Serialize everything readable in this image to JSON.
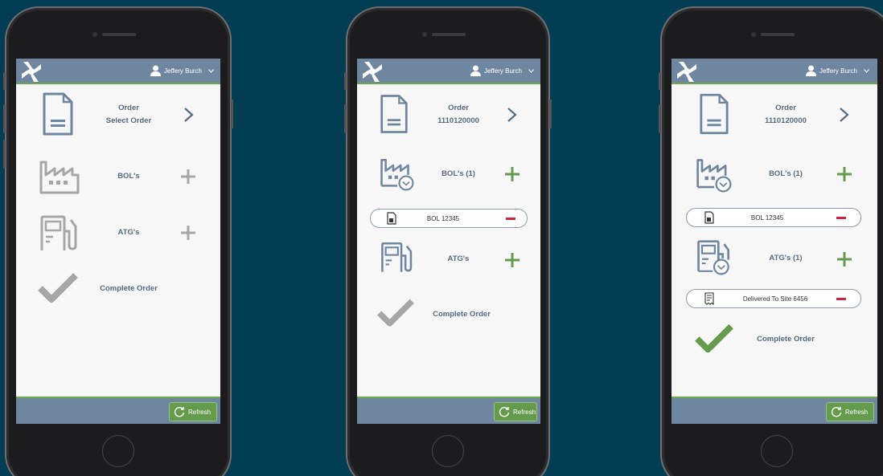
{
  "colors": {
    "background": "#023d54",
    "appbar": "#6f86a0",
    "accent_green": "#649b4c",
    "remove_red": "#d6203f",
    "label_blue": "#556b82",
    "inactive_grey": "#a6a6a6"
  },
  "phones": [
    {
      "user_name": "Jeffery Burch",
      "order_title": "Order",
      "order_value": "Select Order",
      "bols_label": "BOL's",
      "bols_items": [],
      "atgs_label": "ATG's",
      "atgs_items": [],
      "complete_label": "Complete Order",
      "complete_enabled": false,
      "refresh_label": "Refresh"
    },
    {
      "user_name": "Jeffery Burch",
      "order_title": "Order",
      "order_value": "1110120000",
      "bols_label": "BOL's (1)",
      "bols_items": [
        "BOL 12345"
      ],
      "atgs_label": "ATG's",
      "atgs_items": [],
      "complete_label": "Complete Order",
      "complete_enabled": false,
      "refresh_label": "Refresh"
    },
    {
      "user_name": "Jeffery Burch",
      "order_title": "Order",
      "order_value": "1110120000",
      "bols_label": "BOL's (1)",
      "bols_items": [
        "BOL 12345"
      ],
      "atgs_label": "ATG's (1)",
      "atgs_items": [
        "Delivered To Site 6456"
      ],
      "complete_label": "Complete Order",
      "complete_enabled": true,
      "refresh_label": "Refresh"
    }
  ]
}
